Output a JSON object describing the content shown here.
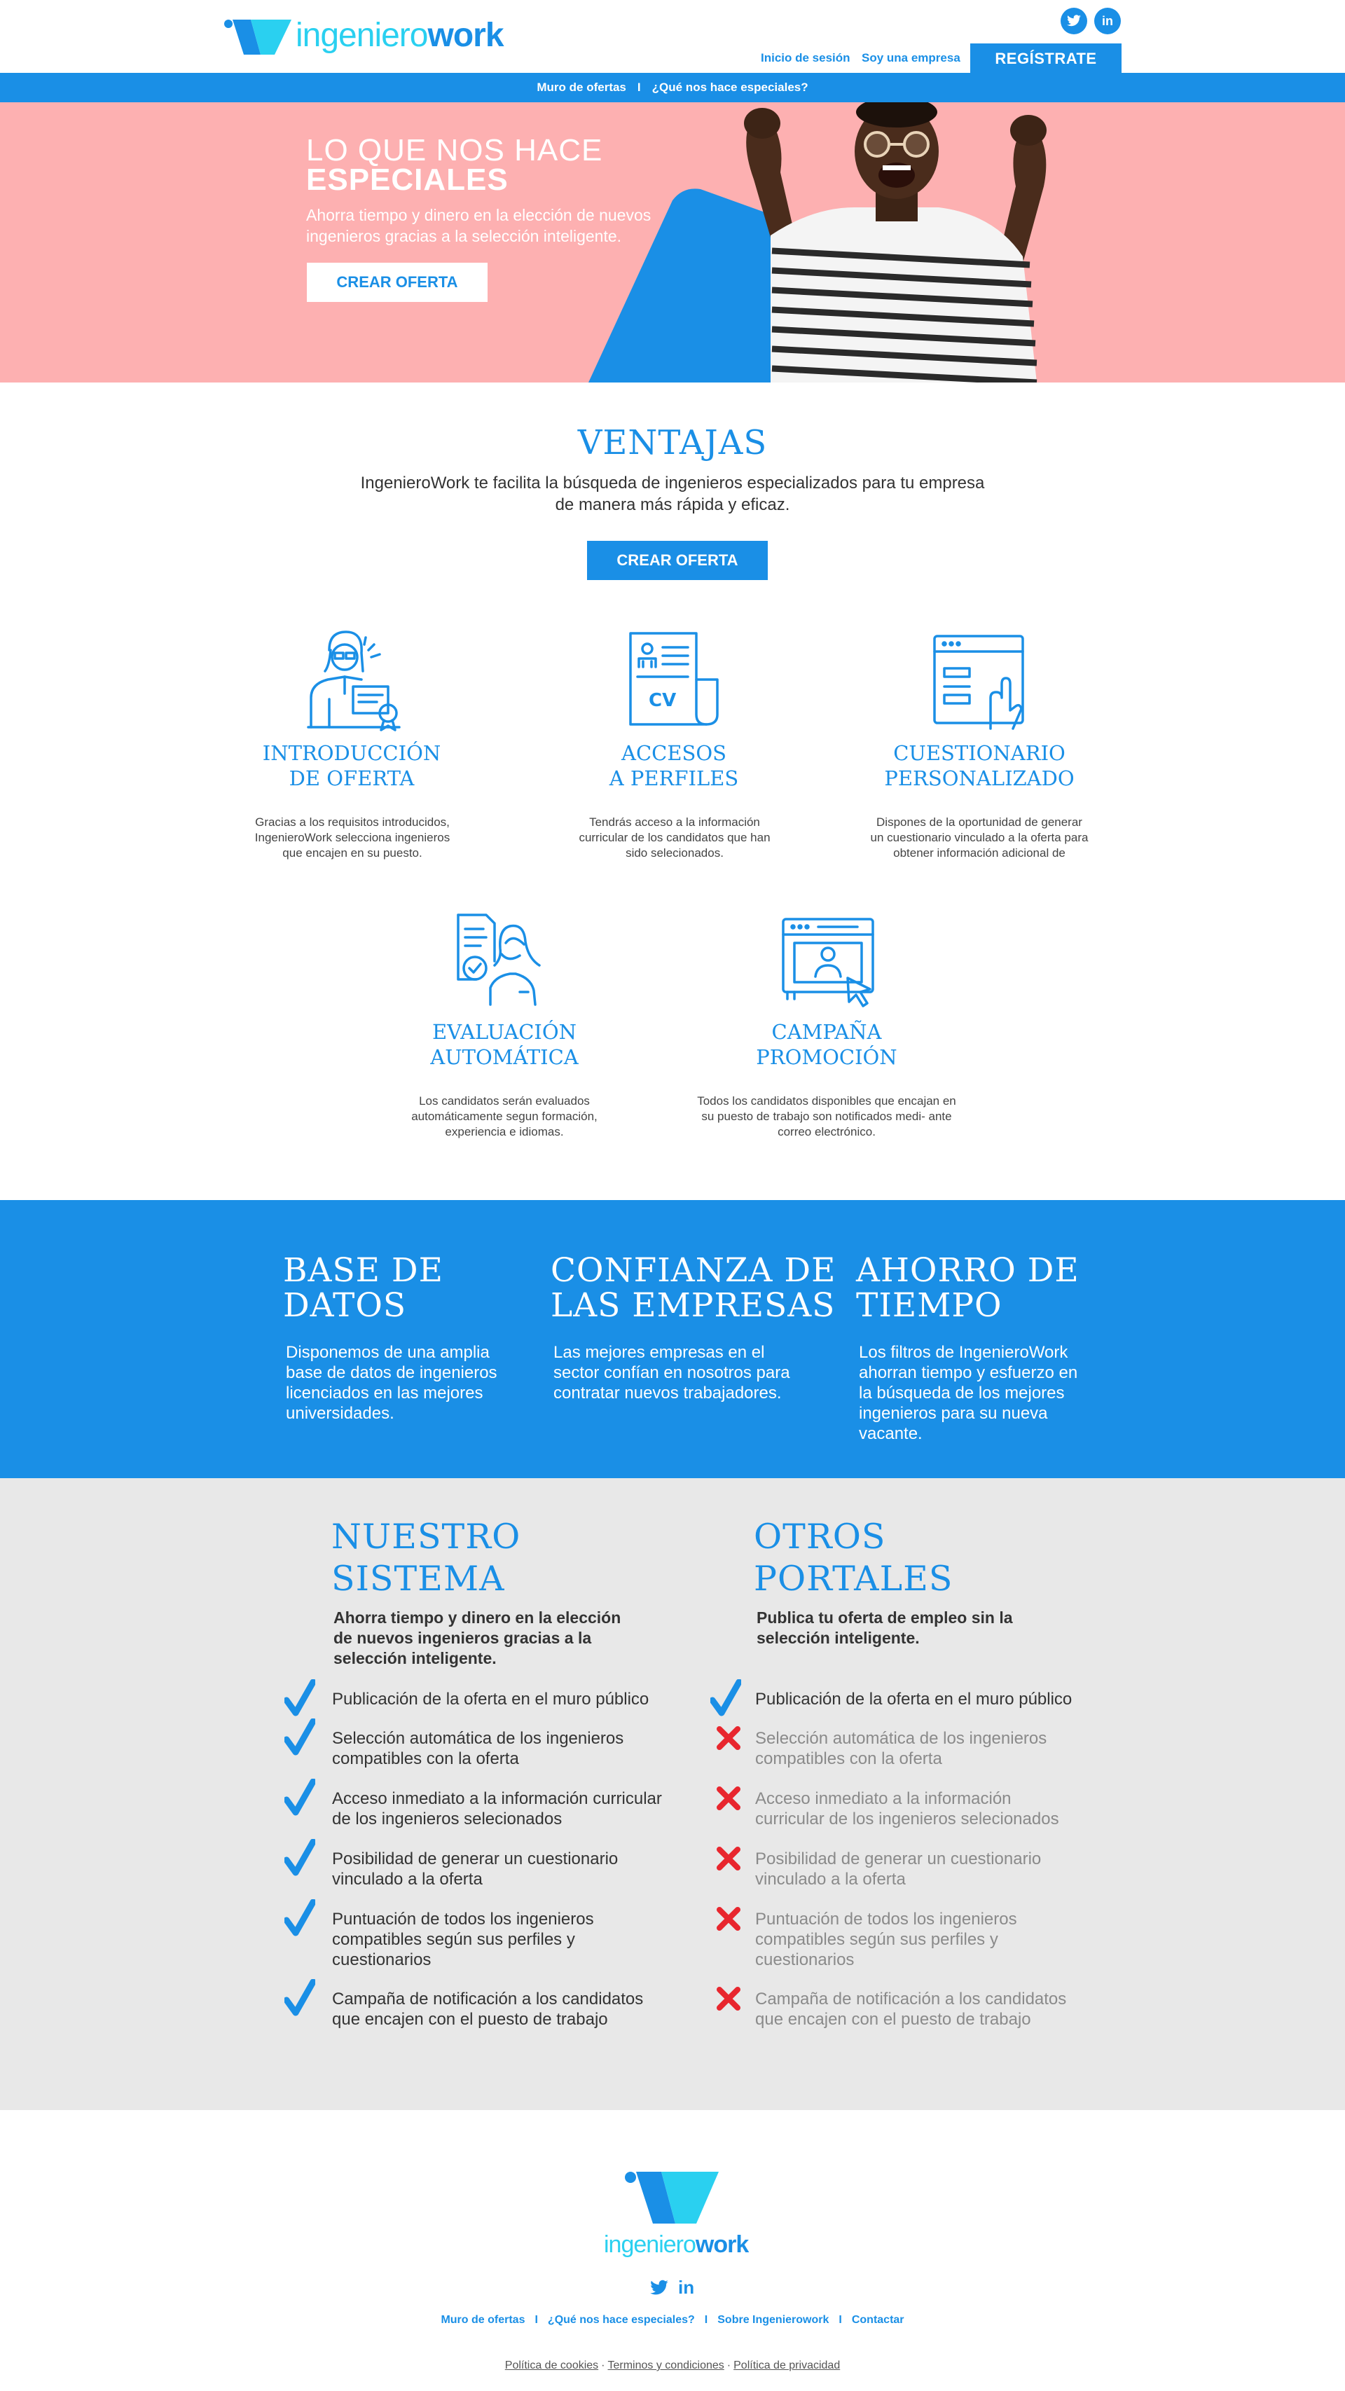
{
  "header": {
    "logo": {
      "part1": "ingeniero",
      "part2": "work"
    },
    "login_label": "Inicio de sesión",
    "company_label": "Soy una empresa",
    "register_label": "REGÍSTRATE",
    "social": {
      "twitter": "t",
      "linkedin": "in"
    }
  },
  "nav": {
    "item1": "Muro de ofertas",
    "separator": "I",
    "item2": "¿Qué nos hace especiales?"
  },
  "hero": {
    "title_line1": "LO QUE NOS HACE",
    "title_line2": "ESPECIALES",
    "subtitle": "Ahorra tiempo y dinero en la elección de nuevos ingenieros gracias a la selección inteligente.",
    "cta": "CREAR OFERTA"
  },
  "advantages": {
    "title": "VENTAJAS",
    "subtitle": "IngenieroWork te facilita la búsqueda de ingenieros especializados para tu empresa de manera más rápida y eficaz.",
    "cta": "CREAR OFERTA",
    "features": [
      {
        "line1": "INTRODUCCIÓN",
        "line2": "DE OFERTA",
        "desc": "Gracias a los requisitos introducidos, IngenieroWork selecciona ingenieros que encajen en su puesto.",
        "icon": "person-certificate-icon"
      },
      {
        "line1": "ACCESOS",
        "line2": "A PERFILES",
        "desc": "Tendrás acceso a la información curricular de los candidatos que han sido selecionados.",
        "icon": "cv-document-icon"
      },
      {
        "line1": "CUESTIONARIO",
        "line2": "PERSONALIZADO",
        "desc": "Dispones de la oportunidad de generar un cuestionario vinculado a la oferta para obtener información adicional de",
        "icon": "questionnaire-click-icon"
      },
      {
        "line1": "EVALUACIÓN",
        "line2": "AUTOMÁTICA",
        "desc": "Los candidatos serán evaluados automáticamente segun formación, experiencia e idiomas.",
        "icon": "evaluation-check-icon"
      },
      {
        "line1": "CAMPAÑA",
        "line2": "PROMOCIÓN",
        "desc": "Todos los candidatos disponibles que encajan en su puesto de trabajo son notificados medi- ante correo electrónico.",
        "icon": "campaign-browser-icon"
      }
    ]
  },
  "band": [
    {
      "line1": "BASE DE",
      "line2": "DATOS",
      "text": "Disponemos de una amplia base de datos de ingenieros licenciados en las mejores universidades."
    },
    {
      "line1": "CONFIANZA DE",
      "line2": "LAS EMPRESAS",
      "text": "Las mejores empresas en el sector confían en nosotros para contratar nuevos trabajadores."
    },
    {
      "line1": "AHORRO DE",
      "line2": "TIEMPO",
      "text": "Los filtros de IngenieroWork ahorran tiempo y esfuerzo en la búsqueda de los mejores ingenieros para su nueva vacante."
    }
  ],
  "comparison": {
    "ours": {
      "line1": "NUESTRO",
      "line2": "SISTEMA",
      "subtitle": "Ahorra tiempo y dinero en la elección de nuevos ingenieros gracias a la selección inteligente."
    },
    "others": {
      "line1": "OTROS",
      "line2": "PORTALES",
      "subtitle": "Publica tu oferta de empleo sin la selección inteligente."
    },
    "items": [
      "Publicación de la oferta en el muro público",
      "Selección automática de los ingenieros compatibles con la oferta",
      "Acceso inmediato a la información curricular de los ingenieros selecionados",
      "Posibilidad de generar un cuestionario vinculado a la oferta",
      "Puntuación de todos los ingenieros compatibles según sus perfiles y cuestionarios",
      "Campaña de notificación a los candidatos que encajen con el puesto de trabajo"
    ],
    "ours_included": [
      true,
      true,
      true,
      true,
      true,
      true
    ],
    "others_included": [
      true,
      false,
      false,
      false,
      false,
      false
    ]
  },
  "footer": {
    "logo": {
      "part1": "ingeniero",
      "part2": "work"
    },
    "links": [
      "Muro de ofertas",
      "¿Qué nos hace especiales?",
      "Sobre Ingenierowork",
      "Contactar"
    ],
    "separator": "I",
    "legal": [
      "Política de cookies",
      "Terminos y condiciones",
      "Política de privacidad"
    ],
    "legal_separator": "·"
  },
  "colors": {
    "brand_blue": "#1a8fe6",
    "cyan": "#2ad0f0",
    "hero_pink": "#fdb0b1",
    "gray_band": "#e8e8e8",
    "cross_red": "#e8262e"
  }
}
